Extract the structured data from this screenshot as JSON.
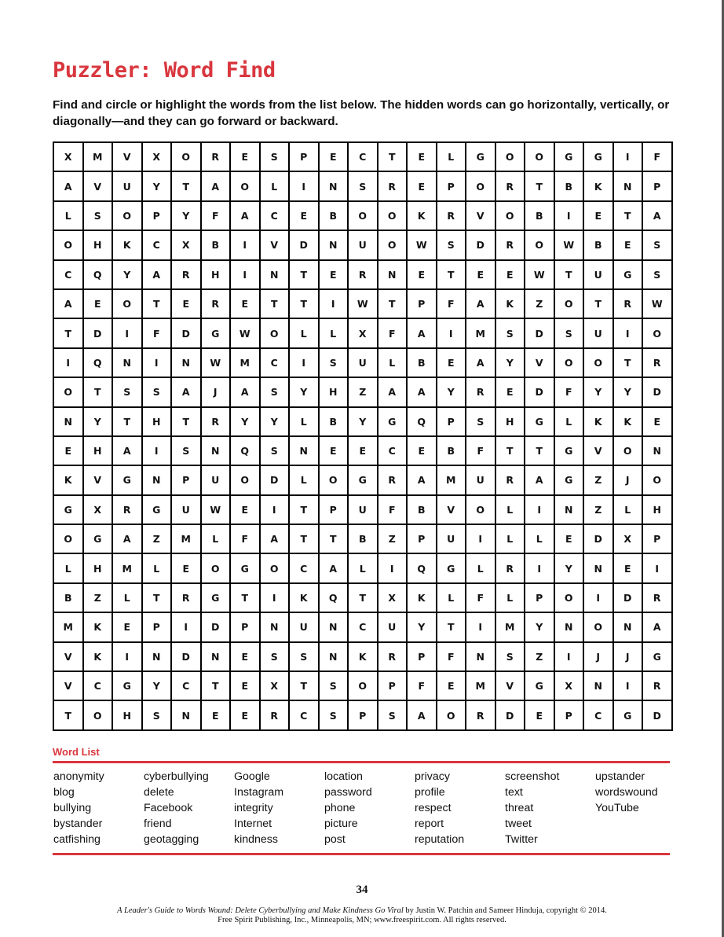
{
  "title": "Puzzler: Word Find",
  "instructions": "Find and circle or highlight the words from the list below. The hidden words can go horizontally, vertically, or diagonally—and they can go forward or backward.",
  "grid": [
    [
      "X",
      "M",
      "V",
      "X",
      "O",
      "R",
      "E",
      "S",
      "P",
      "E",
      "C",
      "T",
      "E",
      "L",
      "G",
      "O",
      "O",
      "G",
      "G",
      "I",
      "F"
    ],
    [
      "A",
      "V",
      "U",
      "Y",
      "T",
      "A",
      "O",
      "L",
      "I",
      "N",
      "S",
      "R",
      "E",
      "P",
      "O",
      "R",
      "T",
      "B",
      "K",
      "N",
      "P"
    ],
    [
      "L",
      "S",
      "O",
      "P",
      "Y",
      "F",
      "A",
      "C",
      "E",
      "B",
      "O",
      "O",
      "K",
      "R",
      "V",
      "O",
      "B",
      "I",
      "E",
      "T",
      "A"
    ],
    [
      "O",
      "H",
      "K",
      "C",
      "X",
      "B",
      "I",
      "V",
      "D",
      "N",
      "U",
      "O",
      "W",
      "S",
      "D",
      "R",
      "O",
      "W",
      "B",
      "E",
      "S"
    ],
    [
      "C",
      "Q",
      "Y",
      "A",
      "R",
      "H",
      "I",
      "N",
      "T",
      "E",
      "R",
      "N",
      "E",
      "T",
      "E",
      "E",
      "W",
      "T",
      "U",
      "G",
      "S"
    ],
    [
      "A",
      "E",
      "O",
      "T",
      "E",
      "R",
      "E",
      "T",
      "T",
      "I",
      "W",
      "T",
      "P",
      "F",
      "A",
      "K",
      "Z",
      "O",
      "T",
      "R",
      "W"
    ],
    [
      "T",
      "D",
      "I",
      "F",
      "D",
      "G",
      "W",
      "O",
      "L",
      "L",
      "X",
      "F",
      "A",
      "I",
      "M",
      "S",
      "D",
      "S",
      "U",
      "I",
      "O"
    ],
    [
      "I",
      "Q",
      "N",
      "I",
      "N",
      "W",
      "M",
      "C",
      "I",
      "S",
      "U",
      "L",
      "B",
      "E",
      "A",
      "Y",
      "V",
      "O",
      "O",
      "T",
      "R"
    ],
    [
      "O",
      "T",
      "S",
      "S",
      "A",
      "J",
      "A",
      "S",
      "Y",
      "H",
      "Z",
      "A",
      "A",
      "Y",
      "R",
      "E",
      "D",
      "F",
      "Y",
      "Y",
      "D"
    ],
    [
      "N",
      "Y",
      "T",
      "H",
      "T",
      "R",
      "Y",
      "Y",
      "L",
      "B",
      "Y",
      "G",
      "Q",
      "P",
      "S",
      "H",
      "G",
      "L",
      "K",
      "K",
      "E"
    ],
    [
      "E",
      "H",
      "A",
      "I",
      "S",
      "N",
      "Q",
      "S",
      "N",
      "E",
      "E",
      "C",
      "E",
      "B",
      "F",
      "T",
      "T",
      "G",
      "V",
      "O",
      "N"
    ],
    [
      "K",
      "V",
      "G",
      "N",
      "P",
      "U",
      "O",
      "D",
      "L",
      "O",
      "G",
      "R",
      "A",
      "M",
      "U",
      "R",
      "A",
      "G",
      "Z",
      "J",
      "O"
    ],
    [
      "G",
      "X",
      "R",
      "G",
      "U",
      "W",
      "E",
      "I",
      "T",
      "P",
      "U",
      "F",
      "B",
      "V",
      "O",
      "L",
      "I",
      "N",
      "Z",
      "L",
      "H"
    ],
    [
      "O",
      "G",
      "A",
      "Z",
      "M",
      "L",
      "F",
      "A",
      "T",
      "T",
      "B",
      "Z",
      "P",
      "U",
      "I",
      "L",
      "L",
      "E",
      "D",
      "X",
      "P"
    ],
    [
      "L",
      "H",
      "M",
      "L",
      "E",
      "O",
      "G",
      "O",
      "C",
      "A",
      "L",
      "I",
      "Q",
      "G",
      "L",
      "R",
      "I",
      "Y",
      "N",
      "E",
      "I"
    ],
    [
      "B",
      "Z",
      "L",
      "T",
      "R",
      "G",
      "T",
      "I",
      "K",
      "Q",
      "T",
      "X",
      "K",
      "L",
      "F",
      "L",
      "P",
      "O",
      "I",
      "D",
      "R"
    ],
    [
      "M",
      "K",
      "E",
      "P",
      "I",
      "D",
      "P",
      "N",
      "U",
      "N",
      "C",
      "U",
      "Y",
      "T",
      "I",
      "M",
      "Y",
      "N",
      "O",
      "N",
      "A"
    ],
    [
      "V",
      "K",
      "I",
      "N",
      "D",
      "N",
      "E",
      "S",
      "S",
      "N",
      "K",
      "R",
      "P",
      "F",
      "N",
      "S",
      "Z",
      "I",
      "J",
      "J",
      "G"
    ],
    [
      "V",
      "C",
      "G",
      "Y",
      "C",
      "T",
      "E",
      "X",
      "T",
      "S",
      "O",
      "P",
      "F",
      "E",
      "M",
      "V",
      "G",
      "X",
      "N",
      "I",
      "R"
    ],
    [
      "T",
      "O",
      "H",
      "S",
      "N",
      "E",
      "E",
      "R",
      "C",
      "S",
      "P",
      "S",
      "A",
      "O",
      "R",
      "D",
      "E",
      "P",
      "C",
      "G",
      "D"
    ]
  ],
  "word_list": {
    "heading": "Word List",
    "columns": [
      [
        "anonymity",
        "blog",
        "bullying",
        "bystander",
        "catfishing"
      ],
      [
        "cyberbullying",
        "delete",
        "Facebook",
        "friend",
        "geotagging"
      ],
      [
        "Google",
        "Instagram",
        "integrity",
        "Internet",
        "kindness"
      ],
      [
        "location",
        "password",
        "phone",
        "picture",
        "post"
      ],
      [
        "privacy",
        "profile",
        "respect",
        "report",
        "reputation"
      ],
      [
        "screenshot",
        "text",
        "threat",
        "tweet",
        "Twitter"
      ],
      [
        "upstander",
        "wordswound",
        "YouTube"
      ]
    ]
  },
  "page_number": "34",
  "footer": {
    "book_title": "A Leader's Guide to Words Wound: Delete Cyberbullying and Make Kindness Go Viral",
    "byline": " by Justin W. Patchin and Sameer Hinduja, copyright © 2014.",
    "publisher": "Free Spirit Publishing, Inc., Minneapolis, MN; www.freespirit.com. All rights reserved."
  },
  "colors": {
    "accent": "#d9363e",
    "text": "#111111",
    "grid_border": "#000000"
  }
}
